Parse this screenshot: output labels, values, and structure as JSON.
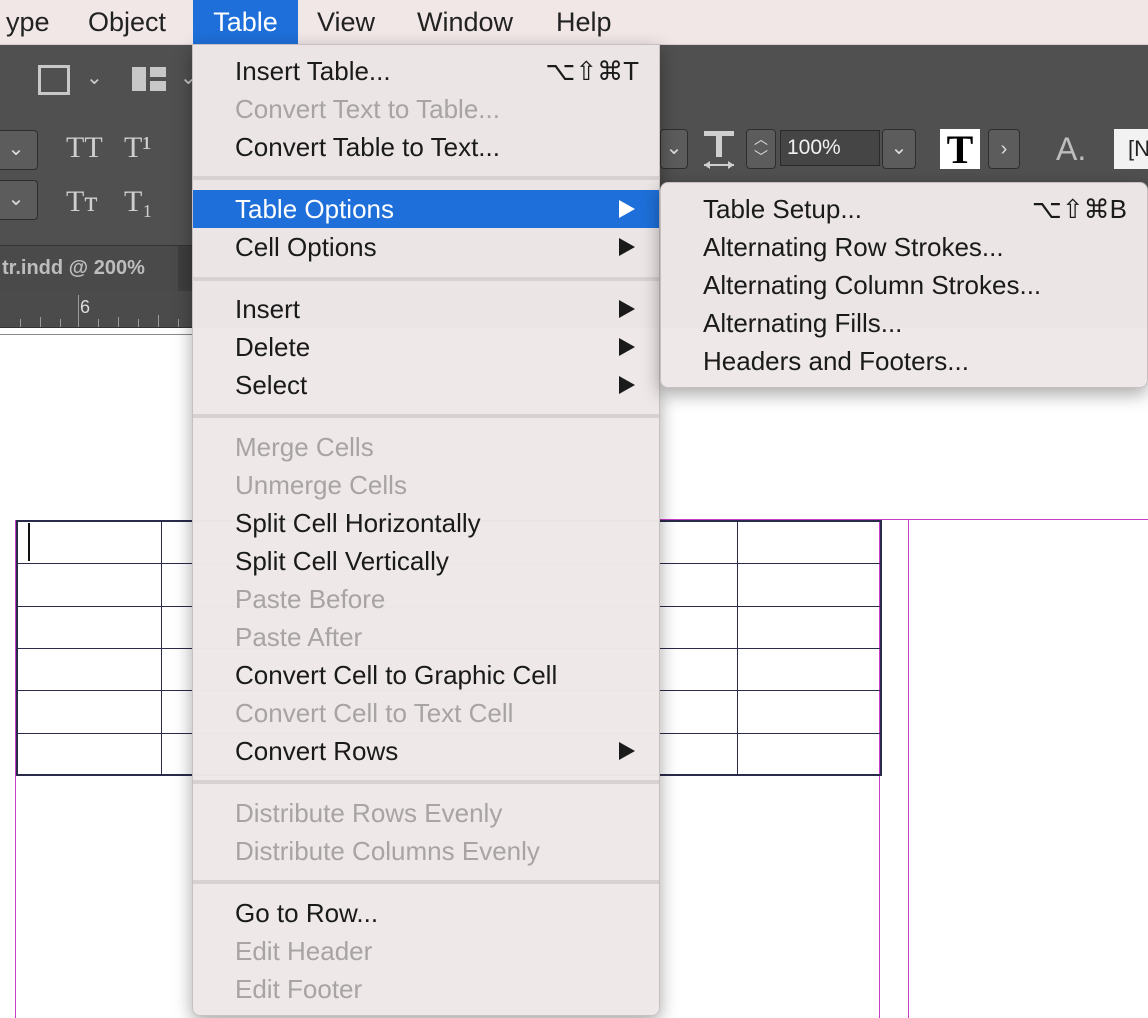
{
  "menubar": {
    "items": [
      "ype",
      "Object",
      "Table",
      "View",
      "Window",
      "Help"
    ],
    "active": "Table"
  },
  "toolbar": {
    "zoom": "100%",
    "glyphs": {
      "all_caps": "TT",
      "superscript": "T¹",
      "small_caps": "Tт",
      "subscript": "T₁",
      "char_style_box": "T",
      "baseline": "A.",
      "style_field": "[N"
    }
  },
  "document": {
    "tab_label": "tr.indd @ 200%",
    "ruler_number": "6"
  },
  "table_menu": {
    "groups": [
      [
        {
          "label": "Insert Table...",
          "shortcut": "⌥⇧⌘T",
          "enabled": true
        },
        {
          "label": "Convert Text to Table...",
          "enabled": false
        },
        {
          "label": "Convert Table to Text...",
          "enabled": true
        }
      ],
      [
        {
          "label": "Table Options",
          "submenu": true,
          "enabled": true,
          "highlighted": true
        },
        {
          "label": "Cell Options",
          "submenu": true,
          "enabled": true
        }
      ],
      [
        {
          "label": "Insert",
          "submenu": true,
          "enabled": true
        },
        {
          "label": "Delete",
          "submenu": true,
          "enabled": true
        },
        {
          "label": "Select",
          "submenu": true,
          "enabled": true
        }
      ],
      [
        {
          "label": "Merge Cells",
          "enabled": false
        },
        {
          "label": "Unmerge Cells",
          "enabled": false
        },
        {
          "label": "Split Cell Horizontally",
          "enabled": true
        },
        {
          "label": "Split Cell Vertically",
          "enabled": true
        },
        {
          "label": "Paste Before",
          "enabled": false
        },
        {
          "label": "Paste After",
          "enabled": false
        },
        {
          "label": "Convert Cell to Graphic Cell",
          "enabled": true
        },
        {
          "label": "Convert Cell to Text Cell",
          "enabled": false
        },
        {
          "label": "Convert Rows",
          "submenu": true,
          "enabled": true
        }
      ],
      [
        {
          "label": "Distribute Rows Evenly",
          "enabled": false
        },
        {
          "label": "Distribute Columns Evenly",
          "enabled": false
        }
      ],
      [
        {
          "label": "Go to Row...",
          "enabled": true
        },
        {
          "label": "Edit Header",
          "enabled": false
        },
        {
          "label": "Edit Footer",
          "enabled": false
        }
      ]
    ]
  },
  "table_options_submenu": {
    "items": [
      {
        "label": "Table Setup...",
        "shortcut": "⌥⇧⌘B"
      },
      {
        "label": "Alternating Row Strokes..."
      },
      {
        "label": "Alternating Column Strokes..."
      },
      {
        "label": "Alternating Fills..."
      },
      {
        "label": "Headers and Footers..."
      }
    ]
  },
  "colors": {
    "highlight": "#1e6fd9",
    "menubar": "#f1e7e7",
    "chrome": "#505050",
    "guide": "#c93bc9"
  }
}
